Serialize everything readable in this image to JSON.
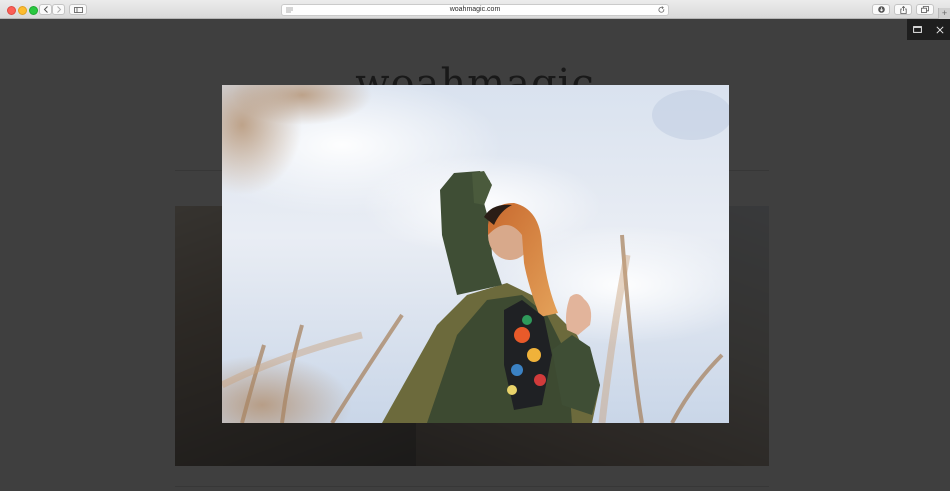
{
  "browser": {
    "url": "woahmagic.com",
    "new_tab_label": "+"
  },
  "page": {
    "site_title": "woahmagic"
  },
  "icons": {
    "back": "chevron-left-icon",
    "forward": "chevron-right-icon",
    "sidebar": "sidebar-icon",
    "reader": "reader-icon",
    "reload": "reload-icon",
    "downloads": "download-icon",
    "share": "share-icon",
    "tabs": "tabs-overview-icon",
    "expand": "expand-icon",
    "close": "close-icon"
  },
  "colors": {
    "overlay": "#181818",
    "lightbox_controls": "#1e1e1e",
    "close": "#fc5f57",
    "minimize": "#fdbc2e",
    "zoom": "#29c840"
  }
}
